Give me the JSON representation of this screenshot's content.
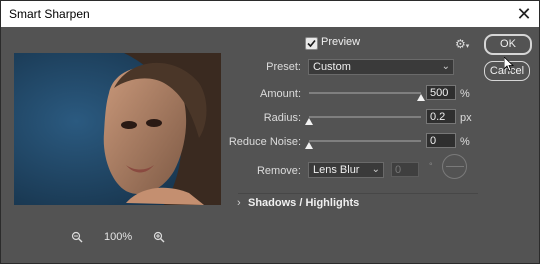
{
  "window": {
    "title": "Smart Sharpen"
  },
  "preview": {
    "checked": true,
    "label": "Preview",
    "zoom": "100%"
  },
  "controls": {
    "preset": {
      "label": "Preset:",
      "value": "Custom"
    },
    "amount": {
      "label": "Amount:",
      "value": "500",
      "unit": "%",
      "level": 1.0
    },
    "radius": {
      "label": "Radius:",
      "value": "0.2",
      "unit": "px",
      "level": 0.0
    },
    "noise": {
      "label": "Reduce Noise:",
      "value": "0",
      "unit": "%",
      "level": 0.0
    },
    "remove": {
      "label": "Remove:",
      "value": "Lens Blur",
      "angle": "0",
      "angle_unit": "°"
    }
  },
  "section": {
    "title": "Shadows / Highlights"
  },
  "buttons": {
    "ok": "OK",
    "cancel": "Cancel"
  },
  "icons": {
    "close": "close-icon",
    "gear": "gear-icon",
    "zoom_out": "zoom-out-icon",
    "zoom_in": "zoom-in-icon"
  }
}
